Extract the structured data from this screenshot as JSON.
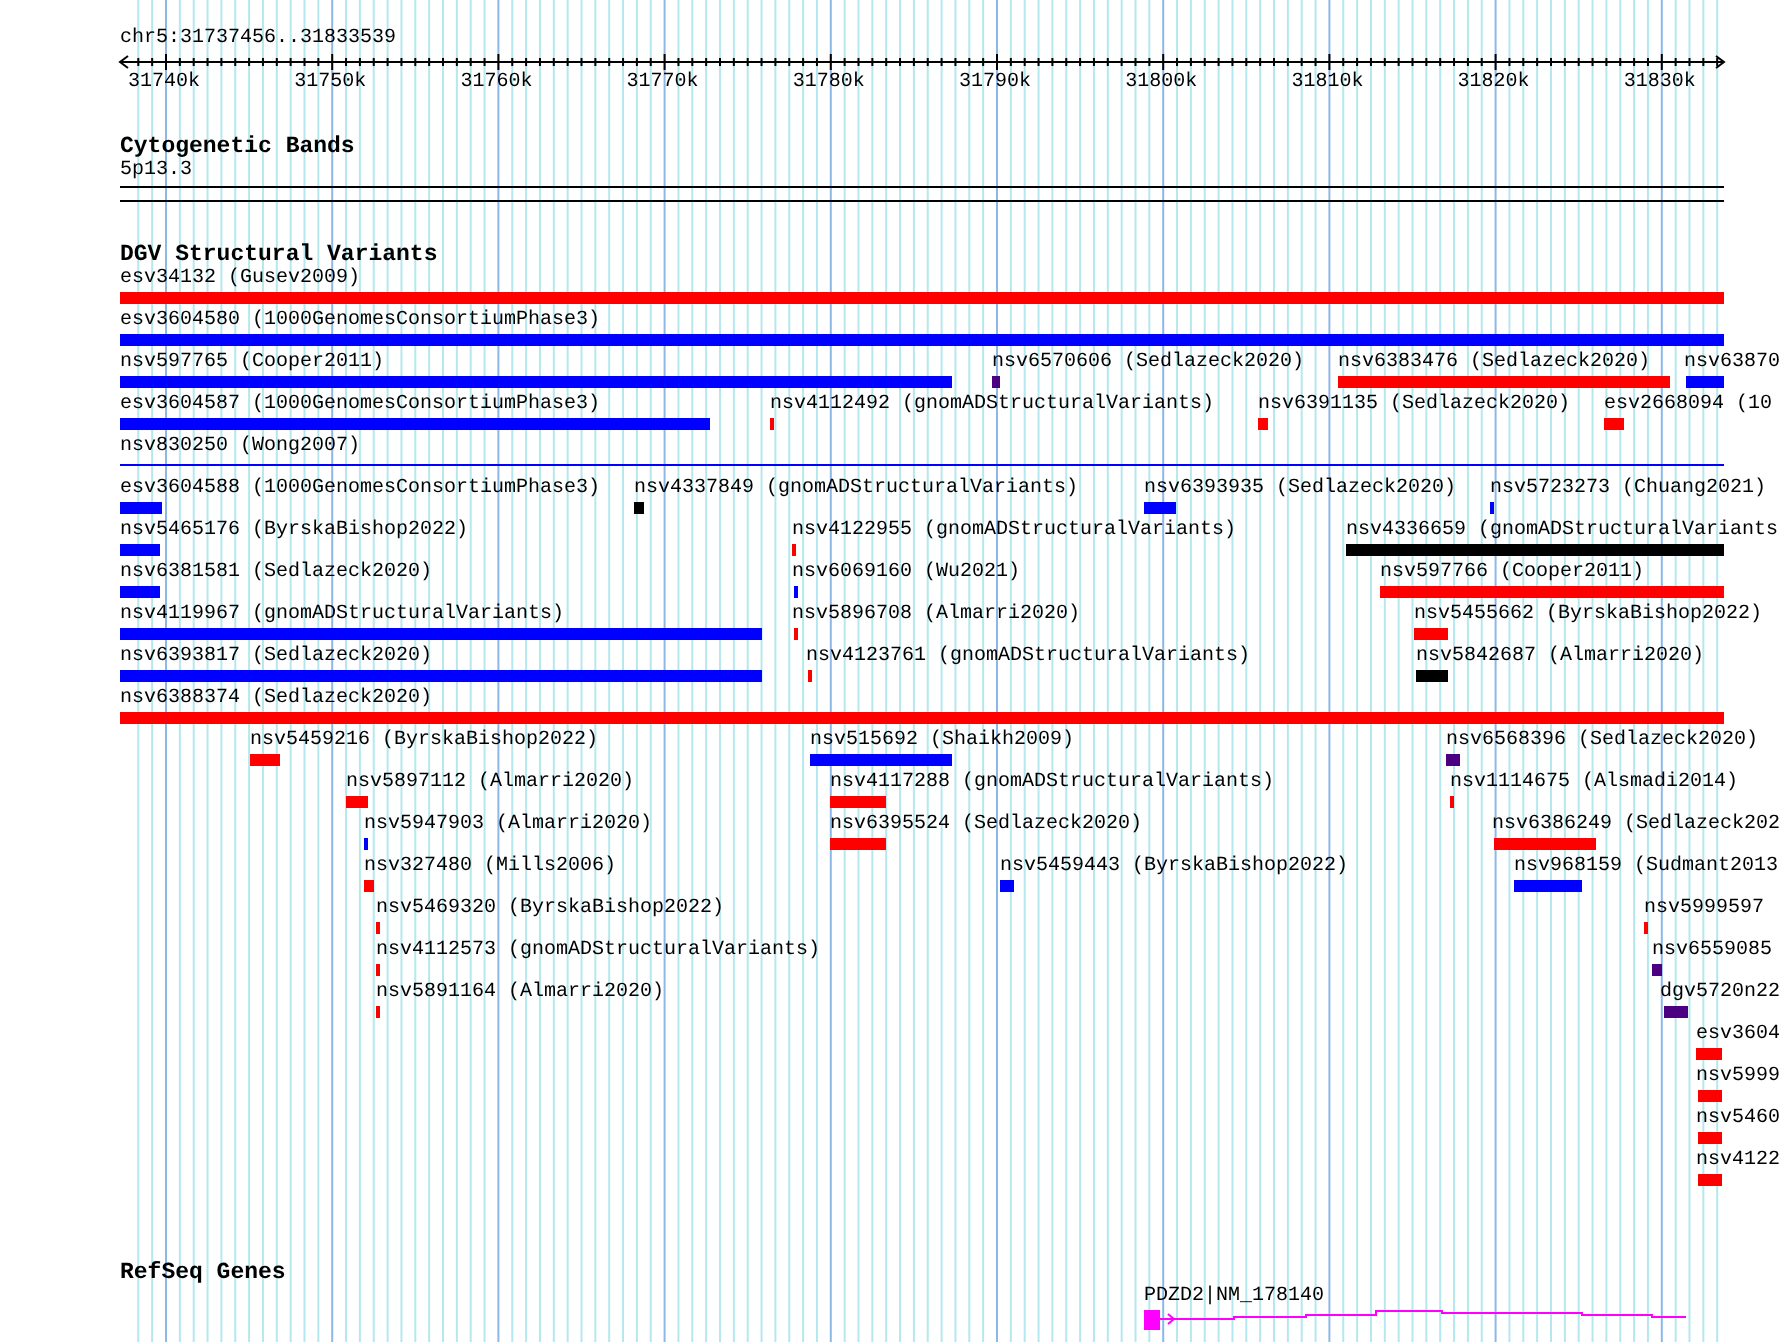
{
  "ruler": {
    "location": "chr5:31737456..31833539",
    "ticks": [
      "31740k",
      "31750k",
      "31760k",
      "31770k",
      "31780k",
      "31790k",
      "31800k",
      "31810k",
      "31820k",
      "31830k"
    ]
  },
  "cytogenetic_bands": {
    "title": "Cytogenetic Bands",
    "band": "5p13.3"
  },
  "dgv_variants": {
    "title": "DGV Structural Variants",
    "features": [
      {
        "label": "esv34132 (Gusev2009)",
        "color": "#ff0000"
      },
      {
        "label": "esv3604580 (1000GenomesConsortiumPhase3)",
        "color": "#0000ff"
      },
      {
        "label": "nsv597765 (Cooper2011)",
        "color": "#0000ff"
      },
      {
        "label": "nsv6570606 (Sedlazeck2020)",
        "color": "#4b0082"
      },
      {
        "label": "nsv6383476 (Sedlazeck2020)",
        "color": "#ff0000"
      },
      {
        "label": "nsv63870",
        "color": "#0000ff"
      },
      {
        "label": "esv3604587 (1000GenomesConsortiumPhase3)",
        "color": "#0000ff"
      },
      {
        "label": "nsv4112492 (gnomADStructuralVariants)",
        "color": "#ff0000"
      },
      {
        "label": "nsv6391135 (Sedlazeck2020)",
        "color": "#ff0000"
      },
      {
        "label": "esv2668094 (10",
        "color": "#ff0000"
      },
      {
        "label": "nsv830250 (Wong2007)",
        "color": "#0000ff"
      },
      {
        "label": "esv3604588 (1000GenomesConsortiumPhase3)",
        "color": "#0000ff"
      },
      {
        "label": "nsv4337849 (gnomADStructuralVariants)",
        "color": "#000000"
      },
      {
        "label": "nsv6393935 (Sedlazeck2020)",
        "color": "#0000ff"
      },
      {
        "label": "nsv5723273 (Chuang2021)",
        "color": "#0000ff"
      },
      {
        "label": "nsv5465176 (ByrskaBishop2022)",
        "color": "#0000ff"
      },
      {
        "label": "nsv4122955 (gnomADStructuralVariants)",
        "color": "#ff0000"
      },
      {
        "label": "nsv4336659 (gnomADStructuralVariants",
        "color": "#000000"
      },
      {
        "label": "nsv6381581 (Sedlazeck2020)",
        "color": "#0000ff"
      },
      {
        "label": "nsv6069160 (Wu2021)",
        "color": "#0000ff"
      },
      {
        "label": "nsv597766 (Cooper2011)",
        "color": "#ff0000"
      },
      {
        "label": "nsv4119967 (gnomADStructuralVariants)",
        "color": "#0000ff"
      },
      {
        "label": "nsv5896708 (Almarri2020)",
        "color": "#ff0000"
      },
      {
        "label": "nsv5455662 (ByrskaBishop2022)",
        "color": "#ff0000"
      },
      {
        "label": "nsv6393817 (Sedlazeck2020)",
        "color": "#0000ff"
      },
      {
        "label": "nsv4123761 (gnomADStructuralVariants)",
        "color": "#ff0000"
      },
      {
        "label": "nsv5842687 (Almarri2020)",
        "color": "#000000"
      },
      {
        "label": "nsv6388374 (Sedlazeck2020)",
        "color": "#ff0000"
      },
      {
        "label": "nsv5459216 (ByrskaBishop2022)",
        "color": "#ff0000"
      },
      {
        "label": "nsv515692 (Shaikh2009)",
        "color": "#0000ff"
      },
      {
        "label": "nsv6568396 (Sedlazeck2020)",
        "color": "#4b0082"
      },
      {
        "label": "nsv5897112 (Almarri2020)",
        "color": "#ff0000"
      },
      {
        "label": "nsv4117288 (gnomADStructuralVariants)",
        "color": "#ff0000"
      },
      {
        "label": "nsv1114675 (Alsmadi2014)",
        "color": "#ff0000"
      },
      {
        "label": "nsv5947903 (Almarri2020)",
        "color": "#0000ff"
      },
      {
        "label": "nsv6395524 (Sedlazeck2020)",
        "color": "#ff0000"
      },
      {
        "label": "nsv6386249 (Sedlazeck202",
        "color": "#ff0000"
      },
      {
        "label": "nsv327480 (Mills2006)",
        "color": "#ff0000"
      },
      {
        "label": "nsv5459443 (ByrskaBishop2022)",
        "color": "#0000ff"
      },
      {
        "label": "nsv968159 (Sudmant2013",
        "color": "#0000ff"
      },
      {
        "label": "nsv5469320 (ByrskaBishop2022)",
        "color": "#ff0000"
      },
      {
        "label": "nsv5999597",
        "color": "#ff0000"
      },
      {
        "label": "nsv4112573 (gnomADStructuralVariants)",
        "color": "#ff0000"
      },
      {
        "label": "nsv6559085",
        "color": "#4b0082"
      },
      {
        "label": "nsv5891164 (Almarri2020)",
        "color": "#ff0000"
      },
      {
        "label": "dgv5720n22",
        "color": "#4b0082"
      },
      {
        "label": "esv3604",
        "color": "#ff0000"
      },
      {
        "label": "nsv5999",
        "color": "#ff0000"
      },
      {
        "label": "nsv5460",
        "color": "#ff0000"
      },
      {
        "label": "nsv4122",
        "color": "#ff0000"
      }
    ]
  },
  "refseq_genes": {
    "title": "RefSeq Genes",
    "gene": "PDZD2|NM_178140"
  }
}
